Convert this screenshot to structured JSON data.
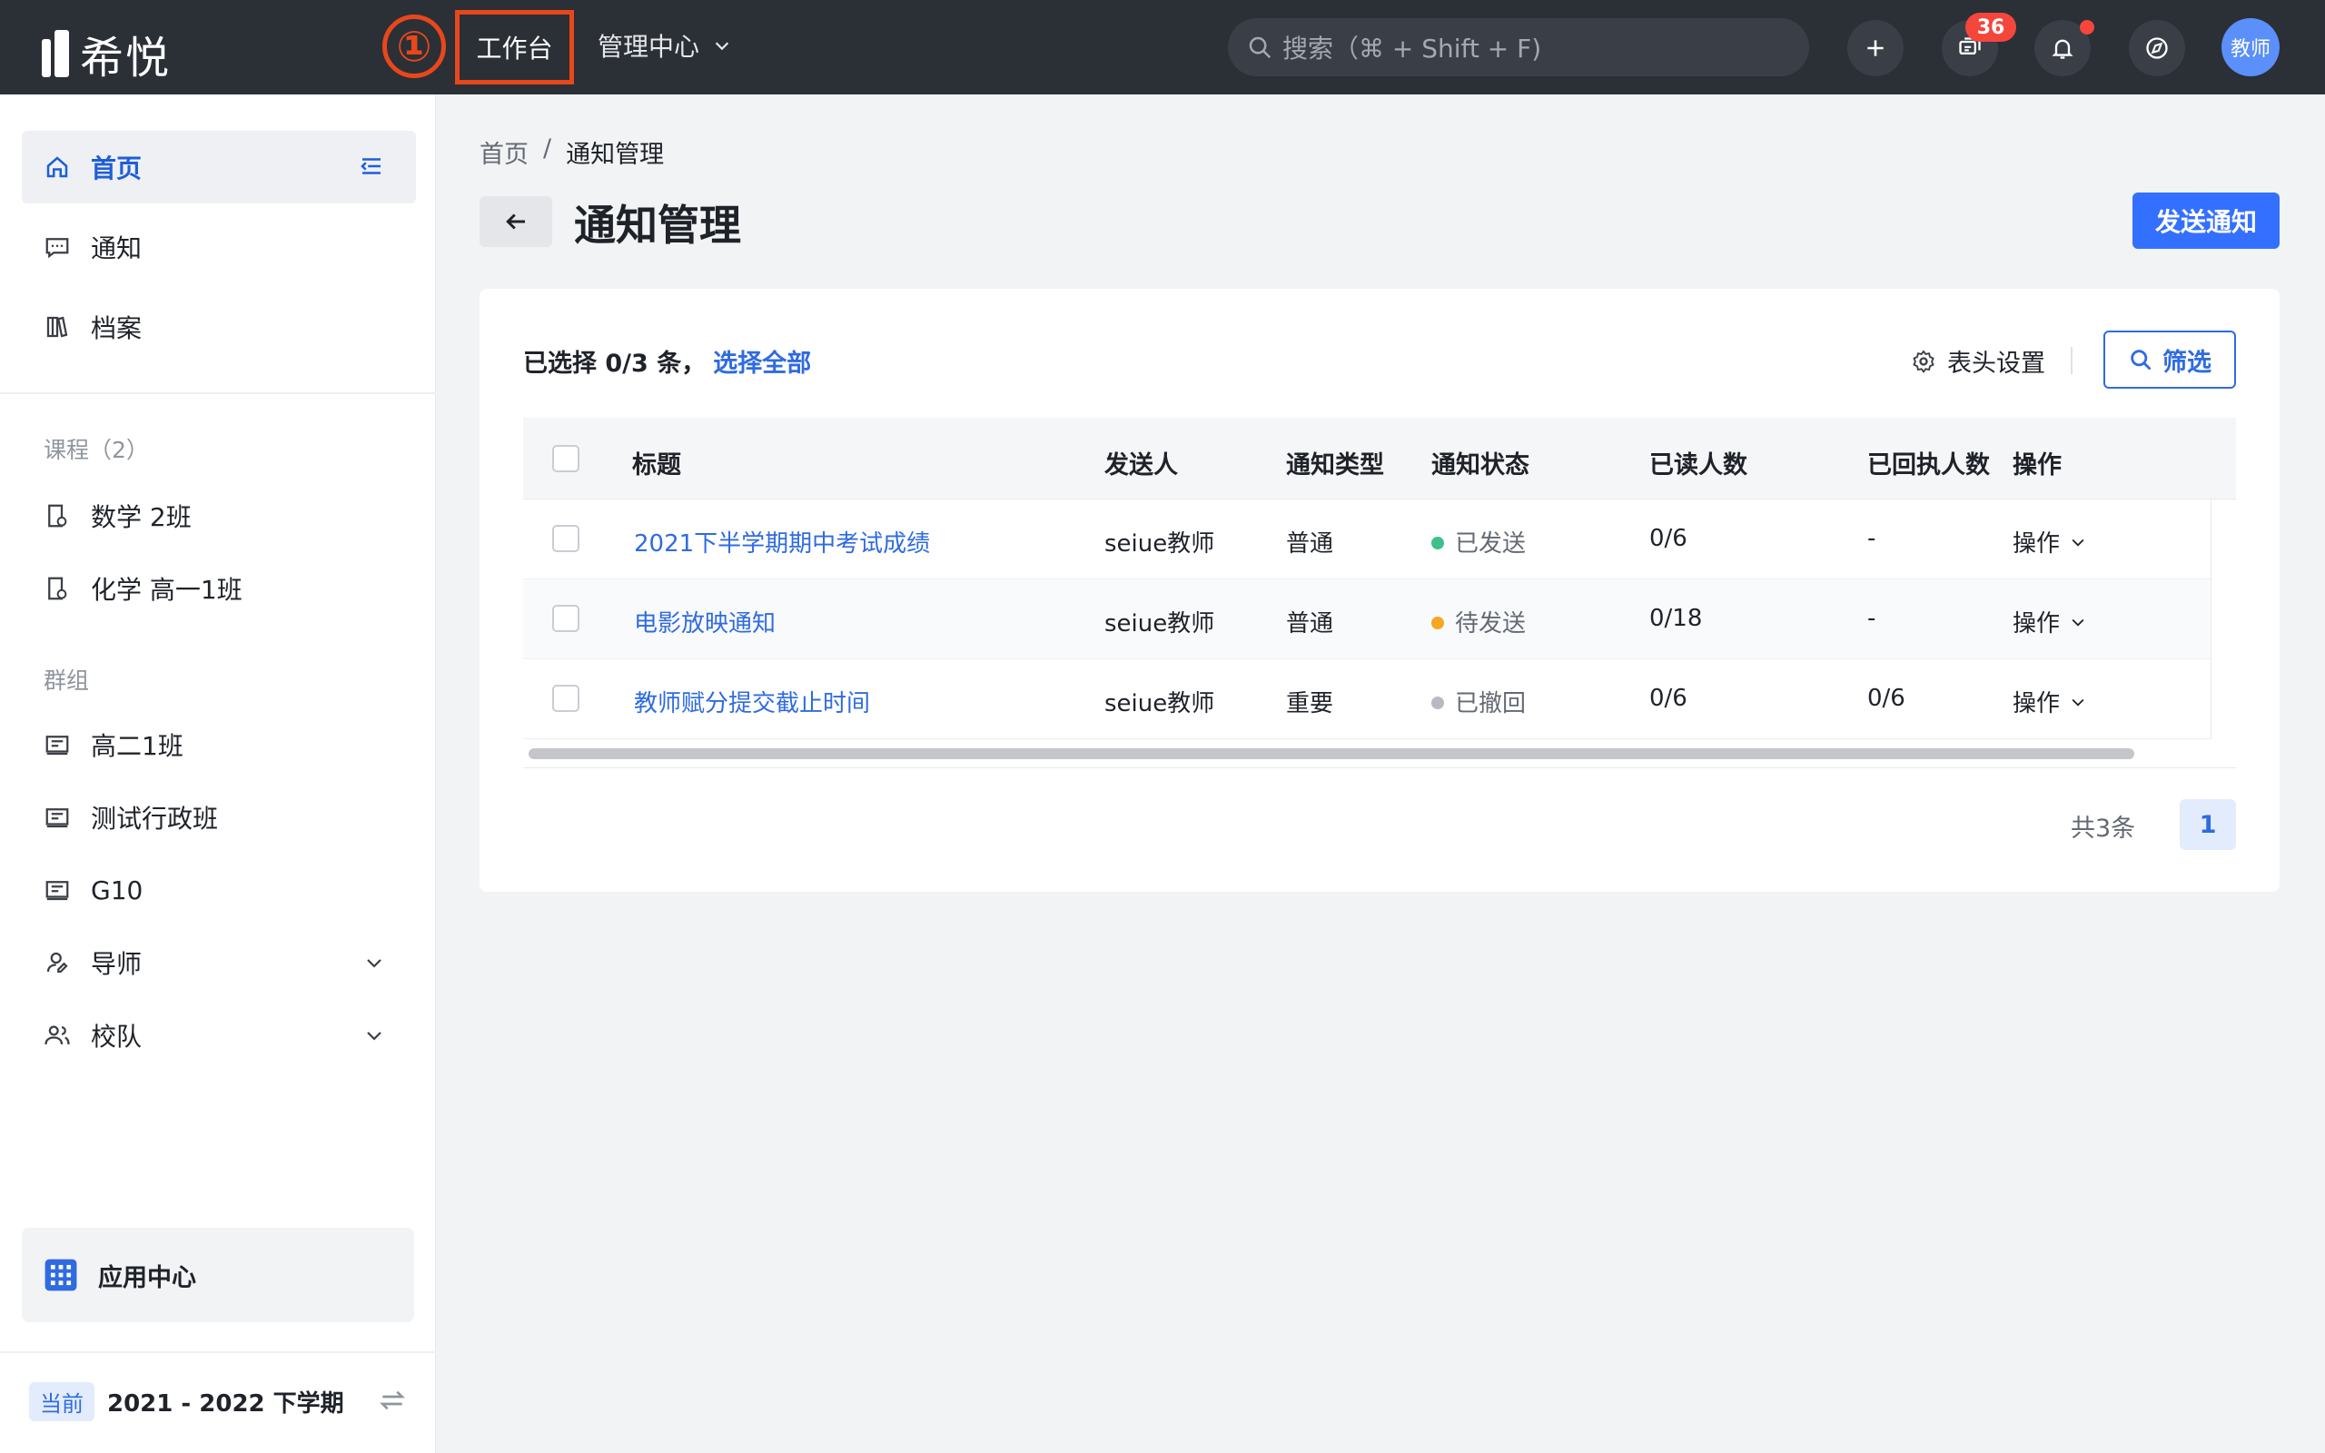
{
  "brand": {
    "name": "希悦"
  },
  "topbar": {
    "step_number": "①",
    "nav_work": "工作台",
    "nav_mgmt": "管理中心",
    "search_placeholder": "搜索（⌘ + Shift + F)",
    "message_badge": "36",
    "avatar_text": "教师"
  },
  "sidebar": {
    "home": "首页",
    "notice": "通知",
    "archive": "档案",
    "courses_title": "课程（2）",
    "courses": [
      "数学 2班",
      "化学 高一1班"
    ],
    "groups_title": "群组",
    "groups": [
      "高二1班",
      "测试行政班",
      "G10"
    ],
    "mentor": "导师",
    "team": "校队",
    "app_center": "应用中心",
    "term_tag": "当前",
    "term": "2021 - 2022 下学期"
  },
  "main": {
    "breadcrumb": {
      "home": "首页",
      "sep": "/",
      "current": "通知管理"
    },
    "title": "通知管理",
    "send_button": "发送通知",
    "selection": {
      "text": "已选择 0/3 条，",
      "select_all": "选择全部"
    },
    "header_settings": "表头设置",
    "filter_button": "筛选",
    "columns": [
      "标题",
      "发送人",
      "通知类型",
      "通知状态",
      "已读人数",
      "已回执人数",
      "操作"
    ],
    "rows": [
      {
        "title": "2021下半学期期中考试成绩",
        "sender": "seiue教师",
        "type": "普通",
        "status": "已发送",
        "read": "0/6",
        "receipt": "-",
        "action": "操作"
      },
      {
        "title": "电影放映通知",
        "sender": "seiue教师",
        "type": "普通",
        "status": "待发送",
        "read": "0/18",
        "receipt": "-",
        "action": "操作"
      },
      {
        "title": "教师赋分提交截止时间",
        "sender": "seiue教师",
        "type": "重要",
        "status": "已撤回",
        "read": "0/6",
        "receipt": "0/6",
        "action": "操作"
      }
    ],
    "total": "共3条",
    "page": "1"
  },
  "colors": {
    "accent": "#3370ff",
    "sent": "#3fbf8a",
    "pending": "#f5a623",
    "revoked": "#b7bbc1",
    "highlight": "#e8471c"
  }
}
